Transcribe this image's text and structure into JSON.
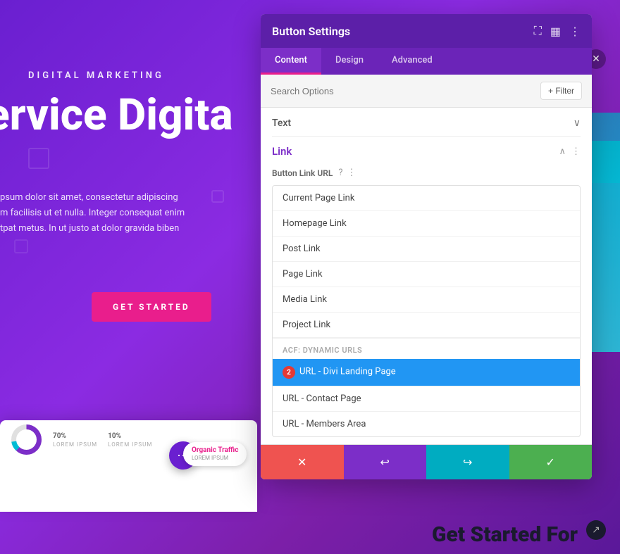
{
  "background": {
    "subtitle": "DIGITAL MARKETING",
    "heading_line1": "ervice Digita",
    "body_text_line1": "psum dolor sit amet, consectetur adipiscing",
    "body_text_line2": "m facilisis ut et nulla. Integer consequat enim",
    "body_text_line3": "tpat metus. In ut justo at dolor gravida biben",
    "cta_button": "GET STARTED",
    "organic_badge": "Organic Traffic",
    "organic_sub": "LOREM IPSUM",
    "get_started_footer": "Get Started For",
    "stat1_pct": "70%",
    "stat1_label": "LOREM IPSUM",
    "stat2_pct": "10%",
    "stat2_label": "LOREM IPSUM"
  },
  "panel": {
    "title": "Button Settings",
    "tabs": [
      {
        "id": "content",
        "label": "Content",
        "active": true
      },
      {
        "id": "design",
        "label": "Design",
        "active": false
      },
      {
        "id": "advanced",
        "label": "Advanced",
        "active": false
      }
    ],
    "search_placeholder": "Search Options",
    "filter_label": "+ Filter",
    "text_section": {
      "title": "Text",
      "collapsed": true
    },
    "link_section": {
      "title": "Link",
      "expanded": true,
      "url_label": "Button Link URL"
    },
    "dropdown_items": [
      {
        "id": "current-page",
        "label": "Current Page Link",
        "group": null,
        "selected": false
      },
      {
        "id": "homepage",
        "label": "Homepage Link",
        "group": null,
        "selected": false
      },
      {
        "id": "post-link",
        "label": "Post Link",
        "group": null,
        "selected": false
      },
      {
        "id": "page-link",
        "label": "Page Link",
        "group": null,
        "selected": false
      },
      {
        "id": "media-link",
        "label": "Media Link",
        "group": null,
        "selected": false
      },
      {
        "id": "project-link",
        "label": "Project Link",
        "group": null,
        "selected": false
      },
      {
        "id": "acf-group",
        "label": "ACF: Dynamic URLs",
        "group": true,
        "selected": false
      },
      {
        "id": "divi-landing",
        "label": "URL - Divi Landing Page",
        "group": null,
        "selected": true
      },
      {
        "id": "contact-page",
        "label": "URL - Contact Page",
        "group": null,
        "selected": false
      },
      {
        "id": "members-area",
        "label": "URL - Members Area",
        "group": null,
        "selected": false
      }
    ],
    "selected_badge_number": "2",
    "toolbar": {
      "cancel_icon": "✕",
      "undo_icon": "↩",
      "redo_icon": "↪",
      "save_icon": "✓"
    }
  }
}
